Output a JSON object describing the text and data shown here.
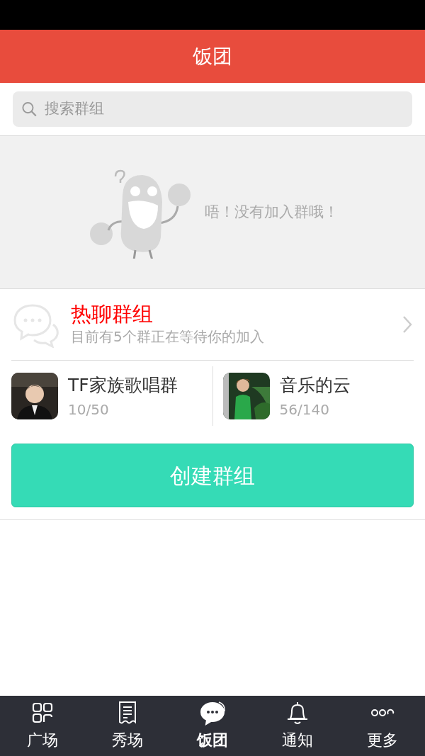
{
  "header": {
    "title": "饭团"
  },
  "search": {
    "placeholder": "搜索群组"
  },
  "empty_state": {
    "message": "唔！没有加入群哦！"
  },
  "hot_groups": {
    "title": "热聊群组",
    "subtitle": "目前有5个群正在等待你的加入"
  },
  "groups": [
    {
      "name": "TF家族歌唱群",
      "members": "10/50",
      "kind": "picture"
    },
    {
      "name": "音乐的云",
      "members": "56/140",
      "kind": "picture"
    }
  ],
  "create_button": "创建群组",
  "tabs": [
    {
      "label": "广场",
      "kind": "grid",
      "selected": false
    },
    {
      "label": "秀场",
      "kind": "receipt",
      "selected": false
    },
    {
      "label": "饭团",
      "kind": "chat",
      "selected": true
    },
    {
      "label": "通知",
      "kind": "bell",
      "selected": false
    },
    {
      "label": "更多",
      "kind": "more",
      "selected": false
    }
  ]
}
